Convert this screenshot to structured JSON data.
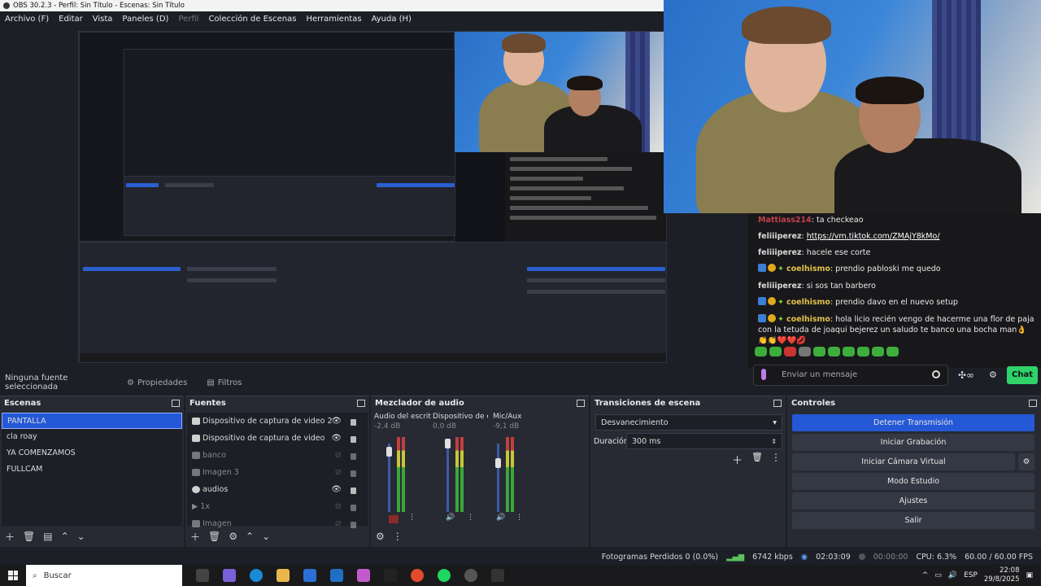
{
  "window": {
    "title": "OBS 30.2.3 - Perfil: Sin Título - Escenas: Sin Título"
  },
  "menu": {
    "items": [
      "Archivo (F)",
      "Editar",
      "Vista",
      "Paneles (D)",
      "Perfil",
      "Colección de Escenas",
      "Herramientas",
      "Ayuda (H)"
    ]
  },
  "chat": {
    "messages": [
      {
        "user": "Mattiass214",
        "text": "ta checkeao"
      },
      {
        "user": "feliiiperez",
        "link": "https://vm.tiktok.com/ZMAjY8kMo/"
      },
      {
        "user": "feliiiperez",
        "text": "hacele ese corte"
      },
      {
        "user": "coelhismo",
        "text": "prendio pabloski me quedo"
      },
      {
        "user": "feliiiperez",
        "text": "si sos tan barbero"
      },
      {
        "user": "coelhismo",
        "text": "prendio davo en el nuevo setup"
      },
      {
        "user": "coelhismo",
        "text": "hola licio recién vengo de hacerme una flor de paja con la tetuda de joaqui bejerez un saludo te banco una bocha man👌👏👏❤️❤️💋"
      }
    ],
    "input_placeholder": "Enviar un mensaje",
    "chat_button": "Chat"
  },
  "source_toolbar": {
    "no_source": "Ninguna fuente seleccionada",
    "properties": "Propiedades",
    "filters": "Filtros"
  },
  "scenes": {
    "title": "Escenas",
    "items": [
      "PANTALLA",
      "cla roay",
      "YA COMENZAMOS",
      "FULLCAM"
    ],
    "selected": "PANTALLA"
  },
  "sources": {
    "title": "Fuentes",
    "items": [
      {
        "name": "Dispositivo de captura de video 2",
        "visible": true
      },
      {
        "name": "Dispositivo de captura de video",
        "visible": true
      },
      {
        "name": "banco",
        "visible": false
      },
      {
        "name": "Imagen 3",
        "visible": false
      },
      {
        "name": "audios",
        "visible": true
      },
      {
        "name": "1x",
        "visible": false
      },
      {
        "name": "Imagen",
        "visible": false
      }
    ]
  },
  "mixer": {
    "title": "Mezclador de audio",
    "channels": [
      {
        "name": "Audio del escritorio",
        "db": "-2,4 dB",
        "level": 0.8
      },
      {
        "name": "Dispositivo de captura de video",
        "db": "0,0 dB",
        "level": 1.0
      },
      {
        "name": "Mic/Aux",
        "db": "-9,1 dB",
        "level": 0.65
      }
    ],
    "scale": [
      "0",
      "-5",
      "-10",
      "-15",
      "-20",
      "-25",
      "-30",
      "-35",
      "-40",
      "-45",
      "-50",
      "-55",
      "-60"
    ]
  },
  "transitions": {
    "title": "Transiciones de escena",
    "selected": "Desvanecimiento",
    "duration_label": "Duración",
    "duration_value": "300 ms"
  },
  "controls": {
    "title": "Controles",
    "buttons": [
      "Detener Transmisión",
      "Iniciar Grabación",
      "Iniciar Cámara Virtual",
      "Modo Estudio",
      "Ajustes",
      "Salir"
    ]
  },
  "status": {
    "dropped": "Fotogramas Perdidos 0 (0.0%)",
    "bitrate": "6742 kbps",
    "stream_time": "02:03:09",
    "rec_time": "00:00:00",
    "cpu": "CPU: 6.3%",
    "fps": "60.00 / 60.00 FPS"
  },
  "taskbar": {
    "search": "Buscar",
    "lang": "ESP",
    "time": "22:08",
    "date": "29/8/2025"
  },
  "colors": {
    "accent": "#2458d6",
    "panel": "#272a33",
    "background": "#1d1f26",
    "chat_green": "#2fd36a"
  }
}
